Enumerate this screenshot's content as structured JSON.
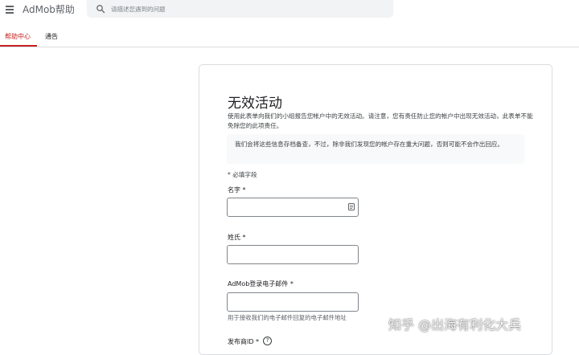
{
  "header": {
    "app_title": "AdMob帮助",
    "search": {
      "placeholder": "请描述您遇到的问题",
      "value": ""
    },
    "icons": {
      "menu": "menu-icon",
      "search": "search-icon"
    }
  },
  "tabs": [
    {
      "label": "帮助中心",
      "active": true
    },
    {
      "label": "通告",
      "active": false
    }
  ],
  "form": {
    "title": "无效活动",
    "description": "使用此表单向我们的小组报告您帐户中的无效活动。请注意，您有责任防止您的帐户中出现无效活动，此表单不能免除您的此项责任。",
    "notice": "我们会将这些信息存档备查，不过，除非我们发现您的帐户存在重大问题，否则可能不会作出回应。",
    "required_note": "* 必填字段",
    "fields": {
      "first_name": {
        "label": "名字 *",
        "value": ""
      },
      "last_name": {
        "label": "姓氏 *",
        "value": ""
      },
      "email": {
        "label": "AdMob登录电子邮件 *",
        "value": "",
        "helper": "用于接收我们的电子邮件回复的电子邮件地址"
      },
      "publisher_id": {
        "label": "发布商ID *",
        "help_icon": "?"
      }
    }
  },
  "watermark": "知乎 @出海有利化大兵",
  "colors": {
    "accent": "#c5221f",
    "search_bg": "#f1f3f4",
    "notice_bg": "#f8f9fa",
    "border": "#dadce0"
  }
}
